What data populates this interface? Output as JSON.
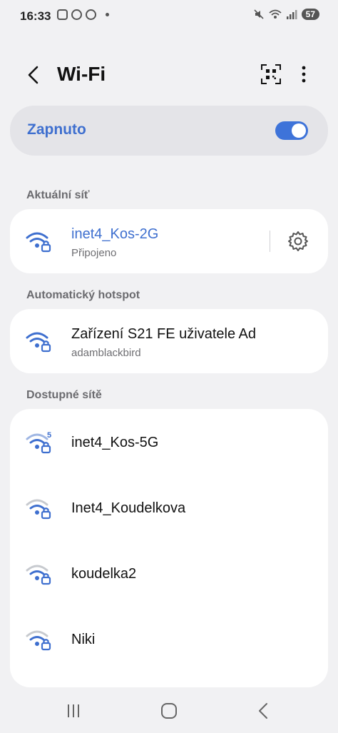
{
  "status": {
    "time": "16:33",
    "battery": "57"
  },
  "appbar": {
    "title": "Wi-Fi"
  },
  "toggle": {
    "label": "Zapnuto",
    "on": true
  },
  "current": {
    "section": "Aktuální síť",
    "name": "inet4_Kos-2G",
    "status": "Připojeno"
  },
  "hotspot": {
    "section": "Automatický hotspot",
    "name": "Zařízení S21 FE uživatele Ad",
    "subtitle": "adamblackbird"
  },
  "available": {
    "section": "Dostupné sítě",
    "networks": [
      {
        "name": "inet4_Kos-5G",
        "badge": "5"
      },
      {
        "name": "Inet4_Koudelkova"
      },
      {
        "name": "koudelka2"
      },
      {
        "name": "Niki"
      }
    ]
  },
  "colors": {
    "accent": "#3e6fcf",
    "background": "#f1f1f3",
    "card": "#ffffff"
  }
}
